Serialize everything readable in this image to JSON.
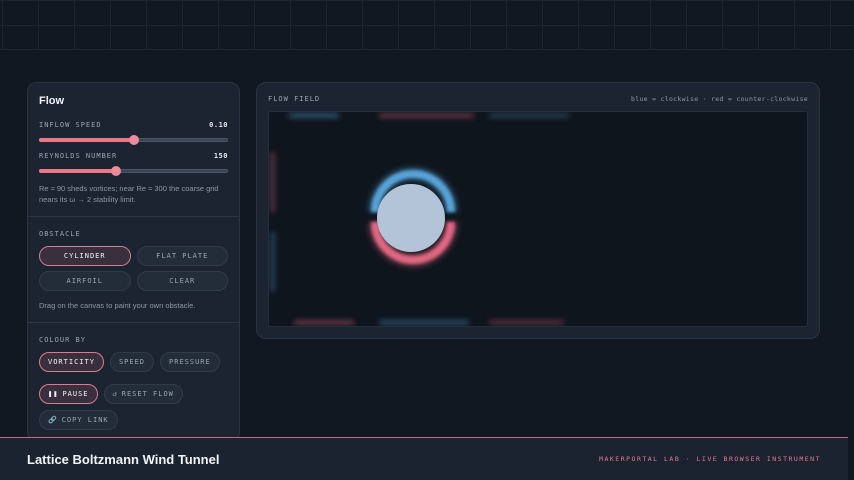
{
  "panel": {
    "title": "Flow",
    "inflow": {
      "label": "INFLOW SPEED",
      "value": "0.10",
      "fraction": 0.5
    },
    "reynolds": {
      "label": "REYNOLDS NUMBER",
      "value": "150",
      "fraction": 0.41
    },
    "hint": "Re ≈ 90 sheds vortices; near Re ≈ 300 the coarse grid nears its ω → 2 stability limit.",
    "obstacle": {
      "label": "OBSTACLE",
      "options": [
        "CYLINDER",
        "FLAT PLATE",
        "AIRFOIL",
        "CLEAR"
      ],
      "active": "CYLINDER",
      "hint": "Drag on the canvas to paint your own obstacle."
    },
    "colour": {
      "label": "COLOUR BY",
      "options": [
        "VORTICITY",
        "SPEED",
        "PRESSURE"
      ],
      "active": "VORTICITY"
    },
    "controls": {
      "pause": "PAUSE",
      "reset": "RESET FLOW",
      "copy": "COPY LINK"
    }
  },
  "field": {
    "title": "FLOW FIELD",
    "legend": "blue = clockwise · red = counter-clockwise",
    "colors": {
      "clockwise": "#5aa9de",
      "counter_clockwise": "#e86a84",
      "obstacle": "#b3c4d8"
    }
  },
  "footer": {
    "title": "Lattice Boltzmann Wind Tunnel",
    "tag": "MAKERPORTAL LAB · LIVE BROWSER INSTRUMENT"
  }
}
